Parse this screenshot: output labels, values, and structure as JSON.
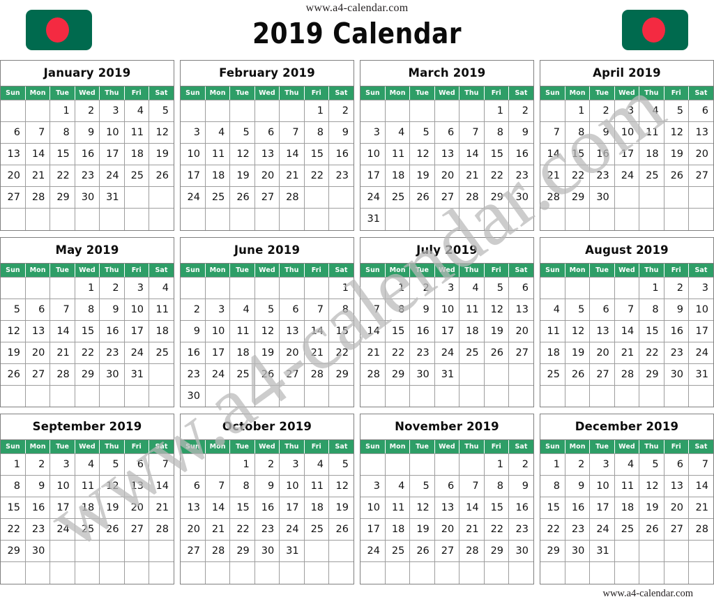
{
  "header": {
    "site_url": "www.a4-calendar.com",
    "title": "2019 Calendar",
    "flag_left_name": "bangladesh-flag-icon",
    "flag_right_name": "bangladesh-flag-icon",
    "flag_green": "#006a4e",
    "flag_red": "#f42a41"
  },
  "watermark": {
    "text": "www.a4-calendar.com",
    "color": "#b9b9b9"
  },
  "footer": {
    "site_url": "www.a4-calendar.com"
  },
  "theme": {
    "header_green": "#2e9e67",
    "header_text": "#ffffff",
    "grid_line": "#9d9d9d",
    "block_border": "#7f7f7f",
    "day_text": "#111111"
  },
  "weekdays": [
    "Sun",
    "Mon",
    "Tue",
    "Wed",
    "Thu",
    "Fri",
    "Sat"
  ],
  "year": 2019,
  "months": [
    {
      "name": "January 2019",
      "weeks": [
        [
          "",
          "",
          "1",
          "2",
          "3",
          "4",
          "5"
        ],
        [
          "6",
          "7",
          "8",
          "9",
          "10",
          "11",
          "12"
        ],
        [
          "13",
          "14",
          "15",
          "16",
          "17",
          "18",
          "19"
        ],
        [
          "20",
          "21",
          "22",
          "23",
          "24",
          "25",
          "26"
        ],
        [
          "27",
          "28",
          "29",
          "30",
          "31",
          "",
          ""
        ],
        [
          "",
          "",
          "",
          "",
          "",
          "",
          ""
        ]
      ]
    },
    {
      "name": "February 2019",
      "weeks": [
        [
          "",
          "",
          "",
          "",
          "",
          "1",
          "2"
        ],
        [
          "3",
          "4",
          "5",
          "6",
          "7",
          "8",
          "9"
        ],
        [
          "10",
          "11",
          "12",
          "13",
          "14",
          "15",
          "16"
        ],
        [
          "17",
          "18",
          "19",
          "20",
          "21",
          "22",
          "23"
        ],
        [
          "24",
          "25",
          "26",
          "27",
          "28",
          "",
          ""
        ],
        [
          "",
          "",
          "",
          "",
          "",
          "",
          ""
        ]
      ]
    },
    {
      "name": "March 2019",
      "weeks": [
        [
          "",
          "",
          "",
          "",
          "",
          "1",
          "2"
        ],
        [
          "3",
          "4",
          "5",
          "6",
          "7",
          "8",
          "9"
        ],
        [
          "10",
          "11",
          "12",
          "13",
          "14",
          "15",
          "16"
        ],
        [
          "17",
          "18",
          "19",
          "20",
          "21",
          "22",
          "23"
        ],
        [
          "24",
          "25",
          "26",
          "27",
          "28",
          "29",
          "30"
        ],
        [
          "31",
          "",
          "",
          "",
          "",
          "",
          ""
        ]
      ]
    },
    {
      "name": "April 2019",
      "weeks": [
        [
          "",
          "1",
          "2",
          "3",
          "4",
          "5",
          "6"
        ],
        [
          "7",
          "8",
          "9",
          "10",
          "11",
          "12",
          "13"
        ],
        [
          "14",
          "15",
          "16",
          "17",
          "18",
          "19",
          "20"
        ],
        [
          "21",
          "22",
          "23",
          "24",
          "25",
          "26",
          "27"
        ],
        [
          "28",
          "29",
          "30",
          "",
          "",
          "",
          ""
        ],
        [
          "",
          "",
          "",
          "",
          "",
          "",
          ""
        ]
      ]
    },
    {
      "name": "May 2019",
      "weeks": [
        [
          "",
          "",
          "",
          "1",
          "2",
          "3",
          "4"
        ],
        [
          "5",
          "6",
          "7",
          "8",
          "9",
          "10",
          "11"
        ],
        [
          "12",
          "13",
          "14",
          "15",
          "16",
          "17",
          "18"
        ],
        [
          "19",
          "20",
          "21",
          "22",
          "23",
          "24",
          "25"
        ],
        [
          "26",
          "27",
          "28",
          "29",
          "30",
          "31",
          ""
        ],
        [
          "",
          "",
          "",
          "",
          "",
          "",
          ""
        ]
      ]
    },
    {
      "name": "June 2019",
      "weeks": [
        [
          "",
          "",
          "",
          "",
          "",
          "",
          "1"
        ],
        [
          "2",
          "3",
          "4",
          "5",
          "6",
          "7",
          "8"
        ],
        [
          "9",
          "10",
          "11",
          "12",
          "13",
          "14",
          "15"
        ],
        [
          "16",
          "17",
          "18",
          "19",
          "20",
          "21",
          "22"
        ],
        [
          "23",
          "24",
          "25",
          "26",
          "27",
          "28",
          "29"
        ],
        [
          "30",
          "",
          "",
          "",
          "",
          "",
          ""
        ]
      ]
    },
    {
      "name": "July 2019",
      "weeks": [
        [
          "",
          "1",
          "2",
          "3",
          "4",
          "5",
          "6"
        ],
        [
          "7",
          "8",
          "9",
          "10",
          "11",
          "12",
          "13"
        ],
        [
          "14",
          "15",
          "16",
          "17",
          "18",
          "19",
          "20"
        ],
        [
          "21",
          "22",
          "23",
          "24",
          "25",
          "26",
          "27"
        ],
        [
          "28",
          "29",
          "30",
          "31",
          "",
          "",
          ""
        ],
        [
          "",
          "",
          "",
          "",
          "",
          "",
          ""
        ]
      ]
    },
    {
      "name": "August 2019",
      "weeks": [
        [
          "",
          "",
          "",
          "",
          "1",
          "2",
          "3"
        ],
        [
          "4",
          "5",
          "6",
          "7",
          "8",
          "9",
          "10"
        ],
        [
          "11",
          "12",
          "13",
          "14",
          "15",
          "16",
          "17"
        ],
        [
          "18",
          "19",
          "20",
          "21",
          "22",
          "23",
          "24"
        ],
        [
          "25",
          "26",
          "27",
          "28",
          "29",
          "30",
          "31"
        ],
        [
          "",
          "",
          "",
          "",
          "",
          "",
          ""
        ]
      ]
    },
    {
      "name": "September 2019",
      "weeks": [
        [
          "1",
          "2",
          "3",
          "4",
          "5",
          "6",
          "7"
        ],
        [
          "8",
          "9",
          "10",
          "11",
          "12",
          "13",
          "14"
        ],
        [
          "15",
          "16",
          "17",
          "18",
          "19",
          "20",
          "21"
        ],
        [
          "22",
          "23",
          "24",
          "25",
          "26",
          "27",
          "28"
        ],
        [
          "29",
          "30",
          "",
          "",
          "",
          "",
          ""
        ],
        [
          "",
          "",
          "",
          "",
          "",
          "",
          ""
        ]
      ]
    },
    {
      "name": "October 2019",
      "weeks": [
        [
          "",
          "",
          "1",
          "2",
          "3",
          "4",
          "5"
        ],
        [
          "6",
          "7",
          "8",
          "9",
          "10",
          "11",
          "12"
        ],
        [
          "13",
          "14",
          "15",
          "16",
          "17",
          "18",
          "19"
        ],
        [
          "20",
          "21",
          "22",
          "23",
          "24",
          "25",
          "26"
        ],
        [
          "27",
          "28",
          "29",
          "30",
          "31",
          "",
          ""
        ],
        [
          "",
          "",
          "",
          "",
          "",
          "",
          ""
        ]
      ]
    },
    {
      "name": "November 2019",
      "weeks": [
        [
          "",
          "",
          "",
          "",
          "",
          "1",
          "2"
        ],
        [
          "3",
          "4",
          "5",
          "6",
          "7",
          "8",
          "9"
        ],
        [
          "10",
          "11",
          "12",
          "13",
          "14",
          "15",
          "16"
        ],
        [
          "17",
          "18",
          "19",
          "20",
          "21",
          "22",
          "23"
        ],
        [
          "24",
          "25",
          "26",
          "27",
          "28",
          "29",
          "30"
        ],
        [
          "",
          "",
          "",
          "",
          "",
          "",
          ""
        ]
      ]
    },
    {
      "name": "December 2019",
      "weeks": [
        [
          "1",
          "2",
          "3",
          "4",
          "5",
          "6",
          "7"
        ],
        [
          "8",
          "9",
          "10",
          "11",
          "12",
          "13",
          "14"
        ],
        [
          "15",
          "16",
          "17",
          "18",
          "19",
          "20",
          "21"
        ],
        [
          "22",
          "23",
          "24",
          "25",
          "26",
          "27",
          "28"
        ],
        [
          "29",
          "30",
          "31",
          "",
          "",
          "",
          ""
        ],
        [
          "",
          "",
          "",
          "",
          "",
          "",
          ""
        ]
      ]
    }
  ]
}
